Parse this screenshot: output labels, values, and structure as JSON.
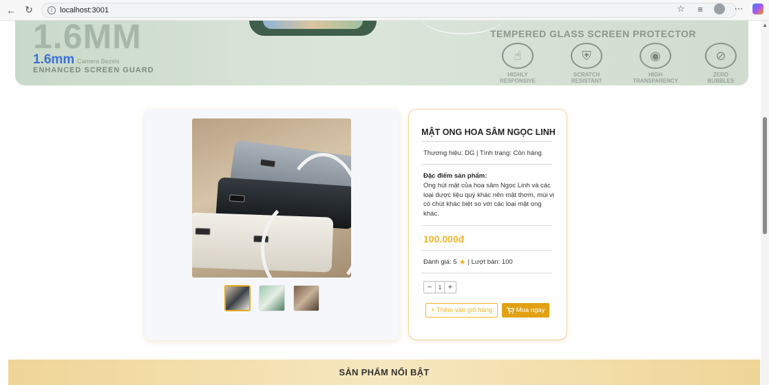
{
  "browser": {
    "url": "localhost:3001"
  },
  "banner": {
    "big_text": "1.6MM",
    "mm_text": "1.6mm",
    "bezel_text": "Camera Bezels",
    "guard_text": "ENHANCED SCREEN GUARD",
    "tempered_text": "TEMPERED GLASS SCREEN PROTECTOR",
    "features": [
      {
        "label_1": "HIGHLY",
        "label_2": "RESPONSIVE",
        "icon": "hand-icon"
      },
      {
        "label_1": "SCRATCH",
        "label_2": "RESISTANT",
        "icon": "shield-icon"
      },
      {
        "label_1": "HIGH",
        "label_2": "TRANSPARENCY",
        "icon": "eye-icon"
      },
      {
        "label_1": "ZERO",
        "label_2": "BUBBLES",
        "icon": "bubbles-icon"
      }
    ]
  },
  "product": {
    "title": "MẬT ONG HOA SÂM NGỌC LINH",
    "brand_line": "Thương hiệu: DG | Tình trạng: Còn hàng",
    "feature_heading": "Đặc điểm sản phẩm:",
    "feature_text": "Ong hút mật của hoa sâm Ngọc Linh và các loại dược liệu quý khác nên mật thơm, mùi vị có chút khác biệt so với các loại mật ong khác.",
    "price": "100.000đ",
    "rating_prefix": "Đánh giá: 5",
    "rating_suffix": "| Lượt bán: 100",
    "quantity": "1",
    "minus": "−",
    "plus": "+",
    "add_to_cart": "+ Thêm vào giỏ hàng",
    "buy_now": "Mua ngay"
  },
  "featured": {
    "title": "SẢN PHẨM NỔI BẬT"
  },
  "colors": {
    "accent": "#f0b429",
    "buy_button": "#e2a111",
    "featured_bar": "#efd597"
  }
}
